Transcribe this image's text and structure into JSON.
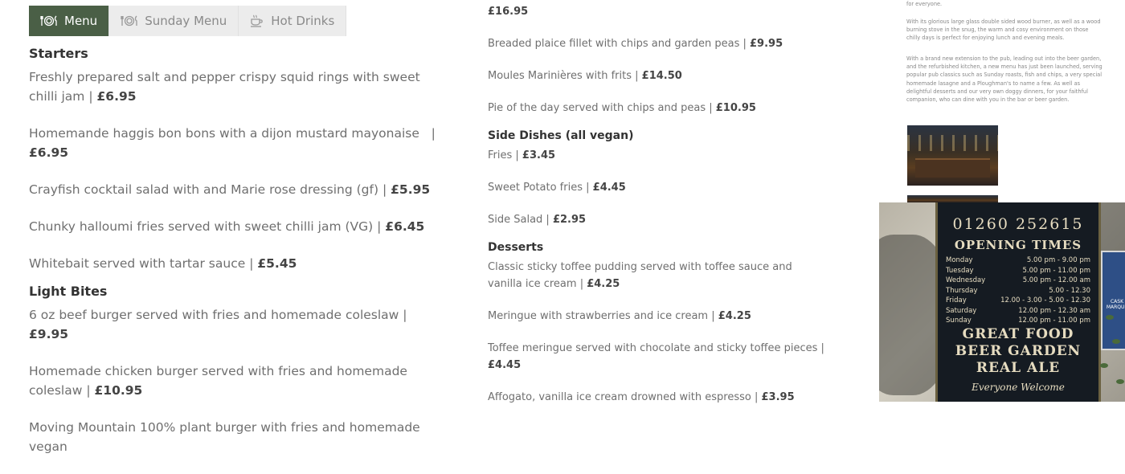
{
  "tabs": [
    {
      "label": "Menu",
      "icon": "plate-cutlery-icon",
      "active": true
    },
    {
      "label": "Sunday Menu",
      "icon": "plate-cutlery-icon",
      "active": false
    },
    {
      "label": "Hot Drinks",
      "icon": "cup-icon",
      "active": false
    }
  ],
  "starters": {
    "title": "Starters",
    "items": [
      {
        "text": "Freshly prepared salt and pepper crispy squid rings with sweet chilli jam |",
        "price": "£6.95"
      },
      {
        "text": "Homemande haggis bon bons with a dijon mustard mayonaise   |",
        "price": "£6.95"
      },
      {
        "text": "Crayfish cocktail salad with and Marie rose dressing (gf) |",
        "price": "£5.95"
      },
      {
        "text": "Chunky halloumi fries served with sweet chilli jam (VG) |",
        "price": "£6.45"
      },
      {
        "text": "Whitebait served with tartar sauce |",
        "price": "£5.45"
      }
    ]
  },
  "light_bites": {
    "title": "Light Bites",
    "items": [
      {
        "text": "6 oz beef burger served with fries and homemade coleslaw |",
        "price": "£9.95"
      },
      {
        "text": "Homemade chicken burger served with fries and homemade coleslaw |",
        "price": "£10.95"
      },
      {
        "text": "Moving Mountain 100% plant burger with fries and homemade vegan",
        "price": ""
      }
    ]
  },
  "mains": {
    "items": [
      {
        "text": "",
        "price": "£16.95"
      },
      {
        "text": "Breaded plaice fillet with chips and garden peas |",
        "price": "£9.95"
      },
      {
        "text": "Moules Marinières with frits |",
        "price": "£14.50"
      },
      {
        "text": "Pie of the day served with chips and peas |",
        "price": "£10.95"
      }
    ]
  },
  "side_dishes": {
    "title": "Side Dishes (all vegan)",
    "items": [
      {
        "text": "Fries |",
        "price": "£3.45"
      },
      {
        "text": "Sweet Potato fries |",
        "price": "£4.45"
      },
      {
        "text": "Side Salad |",
        "price": "£2.95"
      }
    ]
  },
  "desserts": {
    "title": "Desserts",
    "items": [
      {
        "text": "Classic sticky toffee pudding served with toffee sauce and vanilla ice cream |",
        "price": "£4.25"
      },
      {
        "text": "Meringue with strawberries and ice cream |",
        "price": "£4.25"
      },
      {
        "text": "Toffee meringue served with chocolate and sticky toffee pieces |",
        "price": "£4.45"
      },
      {
        "text": "Affogato, vanilla ice cream drowned with espresso |",
        "price": "£3.95"
      }
    ]
  },
  "about": {
    "p0": "for everyone.",
    "p1": "With its glorious large glass double sided wood burner, as well as a wood burning stove in the snug, the warm and cosy environment on those chilly days is perfect for enjoying lunch and evening meals.",
    "p2": "With a brand new extension to the pub, leading out into the beer garden, and the refurbished kitchen, a new menu has just been launched, serving popular pub classics such as Sunday roasts, fish and chips, a very special homemade lasagne and a Ploughman's to name a few. As well as delightful desserts and our very own doggy dinners, for your faithful companion, who can dine with you in the bar or beer garden."
  },
  "sign": {
    "phone": "01260 252615",
    "heading": "OPENING TIMES",
    "hours": [
      {
        "day": "Monday",
        "time": "5.00 pm -  9.00 pm"
      },
      {
        "day": "Tuesday",
        "time": "5.00 pm - 11.00 pm"
      },
      {
        "day": "Wednesday",
        "time": "5.00 pm - 12.00 am"
      },
      {
        "day": "Thursday",
        "time": "5.00 - 12.30"
      },
      {
        "day": "Friday",
        "time": "12.00 - 3.00 - 5.00 - 12.30"
      },
      {
        "day": "Saturday",
        "time": "12.00 pm - 12.30 am"
      },
      {
        "day": "Sunday",
        "time": "12.00 pm - 11.00 pm"
      }
    ],
    "line1": "GREAT FOOD",
    "line2": "BEER GARDEN",
    "line3": "REAL ALE",
    "footer": "Everyone Welcome",
    "side_label": "CASK MARQUE"
  }
}
